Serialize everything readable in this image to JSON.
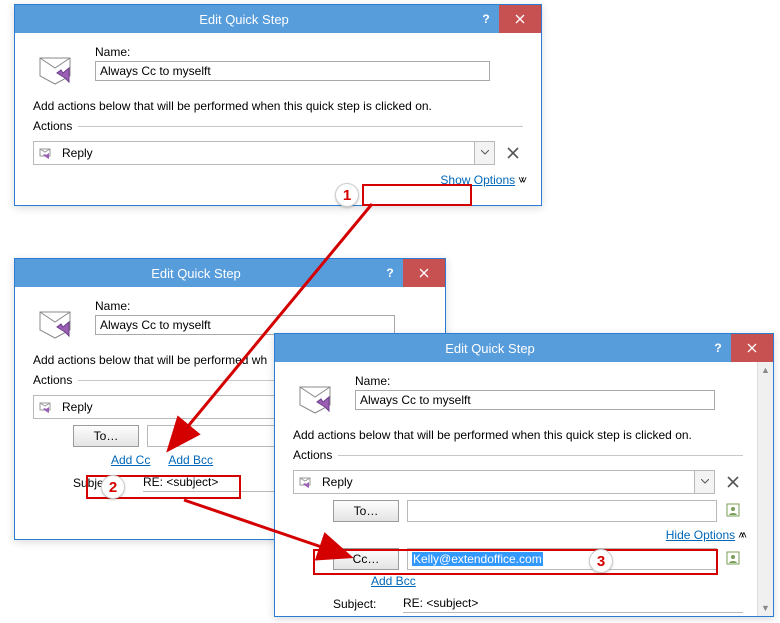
{
  "dlg1": {
    "title": "Edit Quick Step",
    "nameLabel": "Name:",
    "nameValue": "Always Cc to myselft",
    "instruction": "Add actions below that will be performed when this quick step is clicked on.",
    "actionsLabel": "Actions",
    "actionText": "Reply",
    "showOptions": "Show Options"
  },
  "dlg2": {
    "title": "Edit Quick Step",
    "nameLabel": "Name:",
    "nameValue": "Always Cc to myselft",
    "instruction": "Add actions below that will be performed wh",
    "actionsLabel": "Actions",
    "actionText": "Reply",
    "toBtn": "To…",
    "addCc": "Add Cc",
    "addBcc": "Add Bcc",
    "subjectLabel": "Subject:",
    "subjectValue": "RE: <subject>"
  },
  "dlg3": {
    "title": "Edit Quick Step",
    "nameLabel": "Name:",
    "nameValue": "Always Cc to myselft",
    "instruction": "Add actions below that will be performed when this quick step is clicked on.",
    "actionsLabel": "Actions",
    "actionText": "Reply",
    "toBtn": "To…",
    "ccBtn": "Cc…",
    "ccValue": "Kelly@extendoffice.com",
    "hideOptions": "Hide Options",
    "addBcc": "Add Bcc",
    "subjectLabel": "Subject:",
    "subjectValue": "RE: <subject>"
  },
  "annotations": {
    "n1": "1",
    "n2": "2",
    "n3": "3"
  }
}
